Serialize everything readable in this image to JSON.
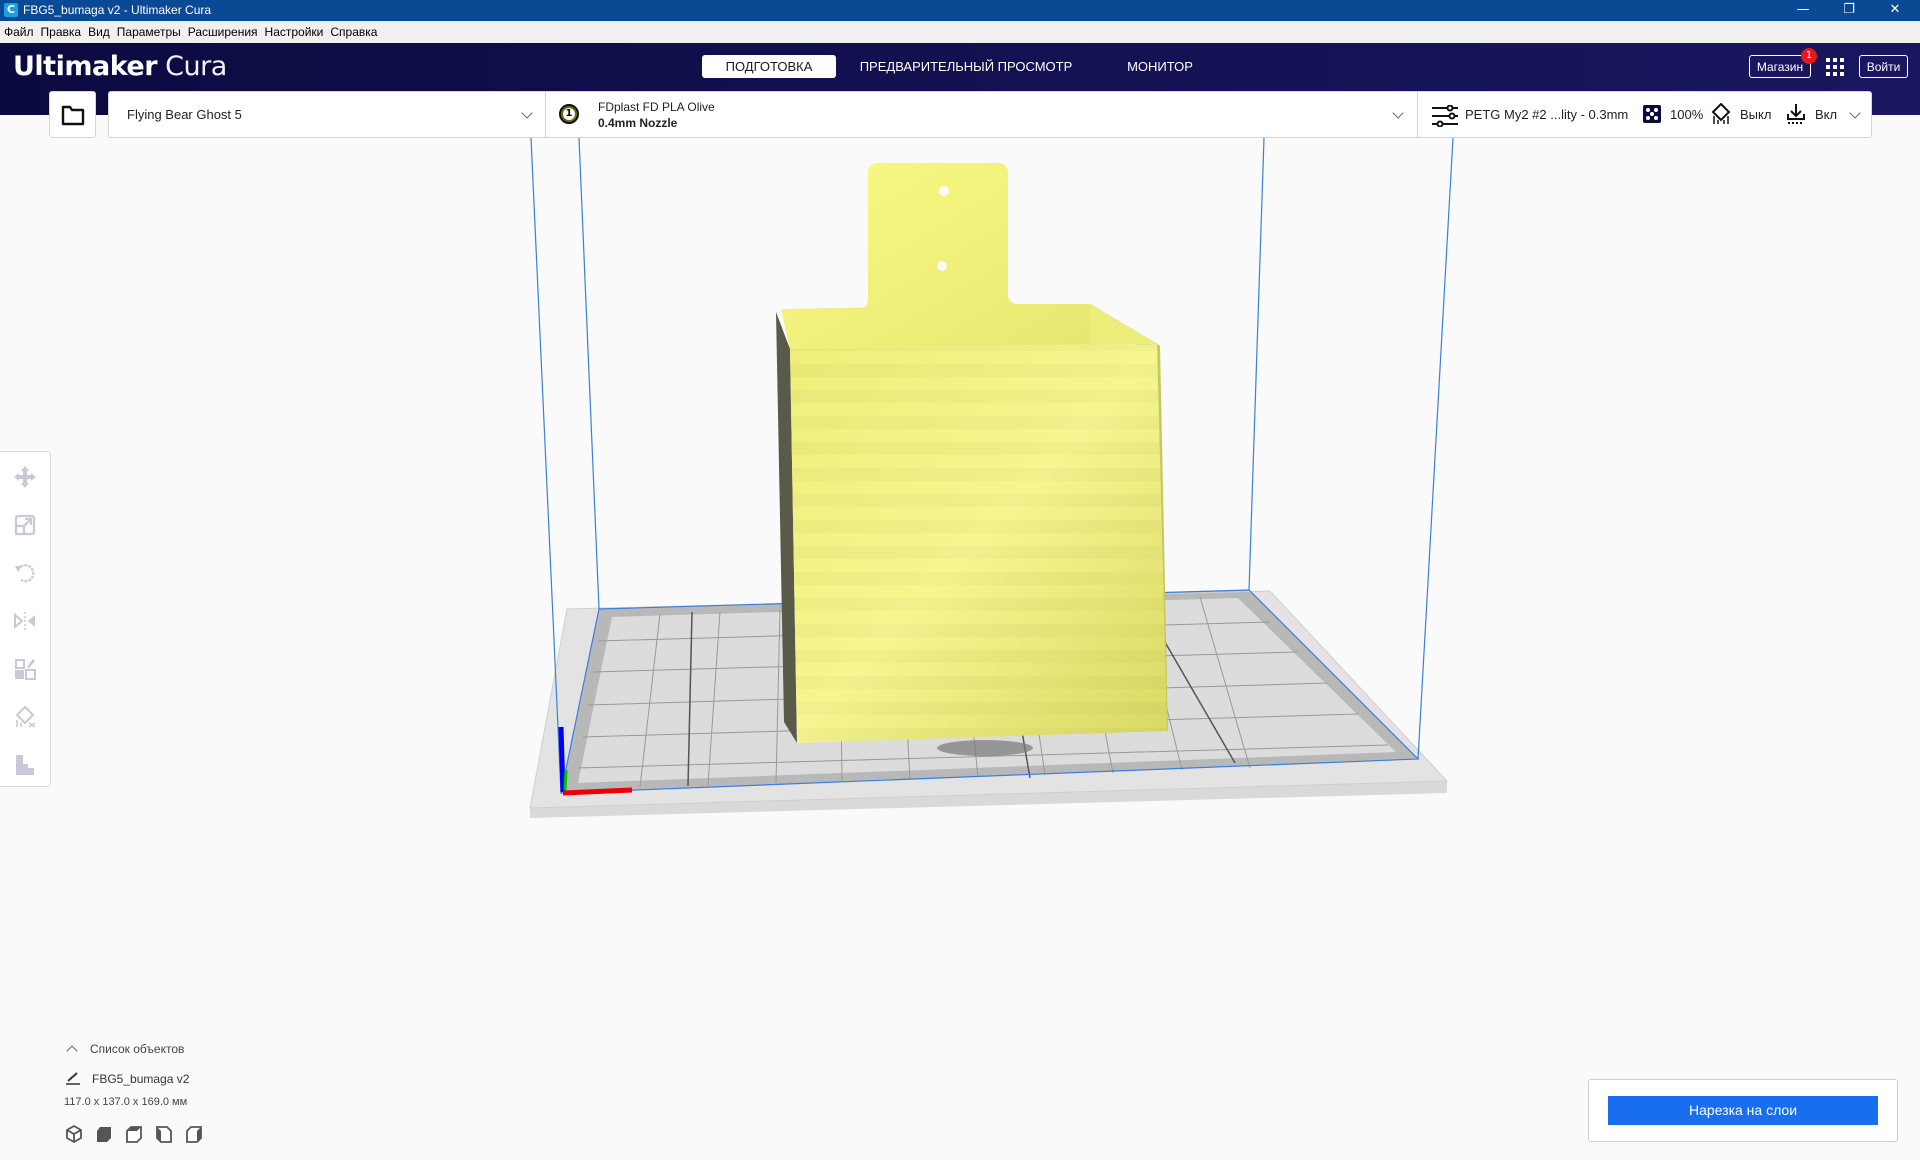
{
  "window": {
    "title": "FBG5_bumaga v2 - Ultimaker Cura",
    "app_icon": "cura-c-icon",
    "controls": [
      "minimize-icon",
      "restore-icon",
      "close-icon"
    ]
  },
  "menu": {
    "items": [
      {
        "label": "Файл"
      },
      {
        "label": "Правка"
      },
      {
        "label": "Вид"
      },
      {
        "label": "Параметры"
      },
      {
        "label": "Расширения"
      },
      {
        "label": "Настройки"
      },
      {
        "label": "Справка"
      }
    ]
  },
  "header": {
    "logo_bold": "Ultimaker",
    "logo_light": "Cura",
    "tabs": [
      {
        "label": "ПОДГОТОВКА",
        "active": true
      },
      {
        "label": "ПРЕДВАРИТЕЛЬНЫЙ ПРОСМОТР",
        "active": false
      },
      {
        "label": "МОНИТОР",
        "active": false
      }
    ],
    "marketplace_label": "Магазин",
    "marketplace_badge": "1",
    "apps_icon": "grid-icon",
    "signin_label": "Войти"
  },
  "toolbar": {
    "open_icon": "folder-icon",
    "printer": "Flying Bear Ghost 5",
    "extruder_number": "1",
    "material": "FDplast FD PLA Olive",
    "nozzle": "0.4mm Nozzle",
    "profile": "PETG My2 #2 ...lity - 0.3mm",
    "infill": "100%",
    "support": "Выкл",
    "adhesion": "Вкл"
  },
  "tools": [
    {
      "name": "move-icon"
    },
    {
      "name": "scale-icon"
    },
    {
      "name": "rotate-icon"
    },
    {
      "name": "mirror-icon"
    },
    {
      "name": "per-model-settings-icon"
    },
    {
      "name": "support-blocker-icon"
    },
    {
      "name": "layflat-icon"
    }
  ],
  "object_list": {
    "title": "Список объектов",
    "object_name": "FBG5_bumaga v2",
    "dimensions": "117.0 x 137.0 x 169.0 мм",
    "view_buttons": [
      "3d-view-icon",
      "front-view-icon",
      "top-view-icon",
      "left-view-icon",
      "right-view-icon"
    ]
  },
  "slice": {
    "button_label": "Нарезка на слои"
  },
  "colors": {
    "header_bg": "#0b0a40",
    "accent_blue": "#196ef0",
    "model_yellow": "#f2f27a",
    "badge_red": "#e01b1b"
  }
}
